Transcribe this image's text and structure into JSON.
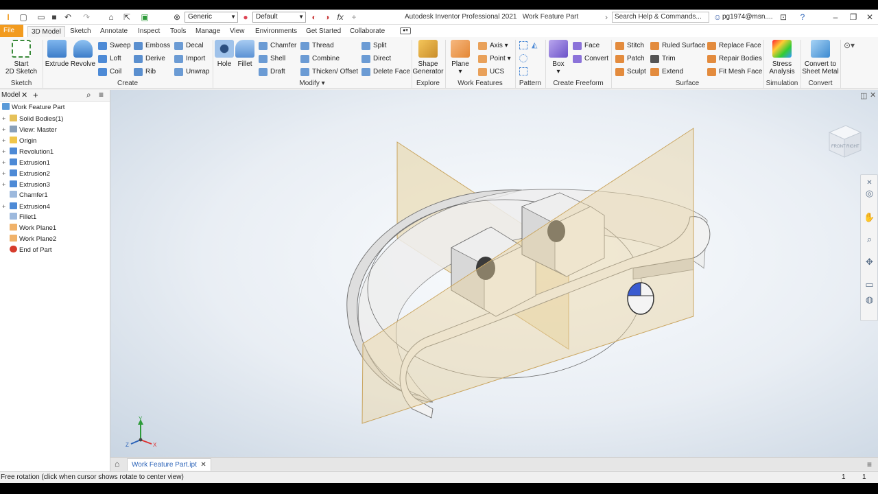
{
  "window": {
    "title": "Autodesk Inventor Professional 2021",
    "document": "Work Feature Part",
    "help_search": "Search Help & Commands...",
    "user": "pg1974@msn....",
    "material": "Generic",
    "appearance": "Default"
  },
  "tabs": [
    "File",
    "3D Model",
    "Sketch",
    "Annotate",
    "Inspect",
    "Tools",
    "Manage",
    "View",
    "Environments",
    "Get Started",
    "Collaborate"
  ],
  "ribbon": {
    "sketch": {
      "start": "Start",
      "start2": "2D Sketch",
      "group": "Sketch"
    },
    "create": {
      "extrude": "Extrude",
      "revolve": "Revolve",
      "sweep": "Sweep",
      "loft": "Loft",
      "coil": "Coil",
      "emboss": "Emboss",
      "derive": "Derive",
      "rib": "Rib",
      "decal": "Decal",
      "import": "Import",
      "unwrap": "Unwrap",
      "group": "Create"
    },
    "modify": {
      "hole": "Hole",
      "fillet": "Fillet",
      "chamfer": "Chamfer",
      "shell": "Shell",
      "draft": "Draft",
      "thread": "Thread",
      "combine": "Combine",
      "thicken": "Thicken/ Offset",
      "split": "Split",
      "direct": "Direct",
      "delete_face": "Delete Face",
      "group": "Modify"
    },
    "explore": {
      "shape": "Shape",
      "shape2": "Generator",
      "group": "Explore"
    },
    "work": {
      "plane": "Plane",
      "axis": "Axis",
      "point": "Point",
      "ucs": "UCS",
      "group": "Work Features"
    },
    "pattern": {
      "group": "Pattern"
    },
    "freeform": {
      "box": "Box",
      "face": "Face",
      "convert": "Convert",
      "group": "Create Freeform"
    },
    "surface": {
      "stitch": "Stitch",
      "patch": "Patch",
      "sculpt": "Sculpt",
      "ruled": "Ruled Surface",
      "trim": "Trim",
      "extend": "Extend",
      "replace": "Replace Face",
      "repair": "Repair Bodies",
      "fitmesh": "Fit Mesh Face",
      "group": "Surface"
    },
    "simulation": {
      "stress": "Stress",
      "stress2": "Analysis",
      "group": "Simulation"
    },
    "convert": {
      "sheet": "Convert to",
      "sheet2": "Sheet Metal",
      "group": "Convert"
    }
  },
  "browser": {
    "tab": "Model",
    "root": "Work Feature Part",
    "items": [
      "Solid Bodies(1)",
      "View: Master",
      "Origin",
      "Revolution1",
      "Extrusion1",
      "Extrusion2",
      "Extrusion3",
      "Chamfer1",
      "Extrusion4",
      "Fillet1",
      "Work Plane1",
      "Work Plane2",
      "End of Part"
    ]
  },
  "viewcube": {
    "front": "FRONT",
    "right": "RIGHT"
  },
  "axes": {
    "x": "X",
    "y": "Y",
    "z": "Z"
  },
  "doc_tab": "Work Feature Part.ipt",
  "status": {
    "message": "Free rotation (click when cursor shows rotate to center view)",
    "count1": "1",
    "count2": "1"
  },
  "colors": {
    "file_tab": "#f29b1f",
    "accent": "#2a62b8",
    "plane": "#e6c98a"
  }
}
